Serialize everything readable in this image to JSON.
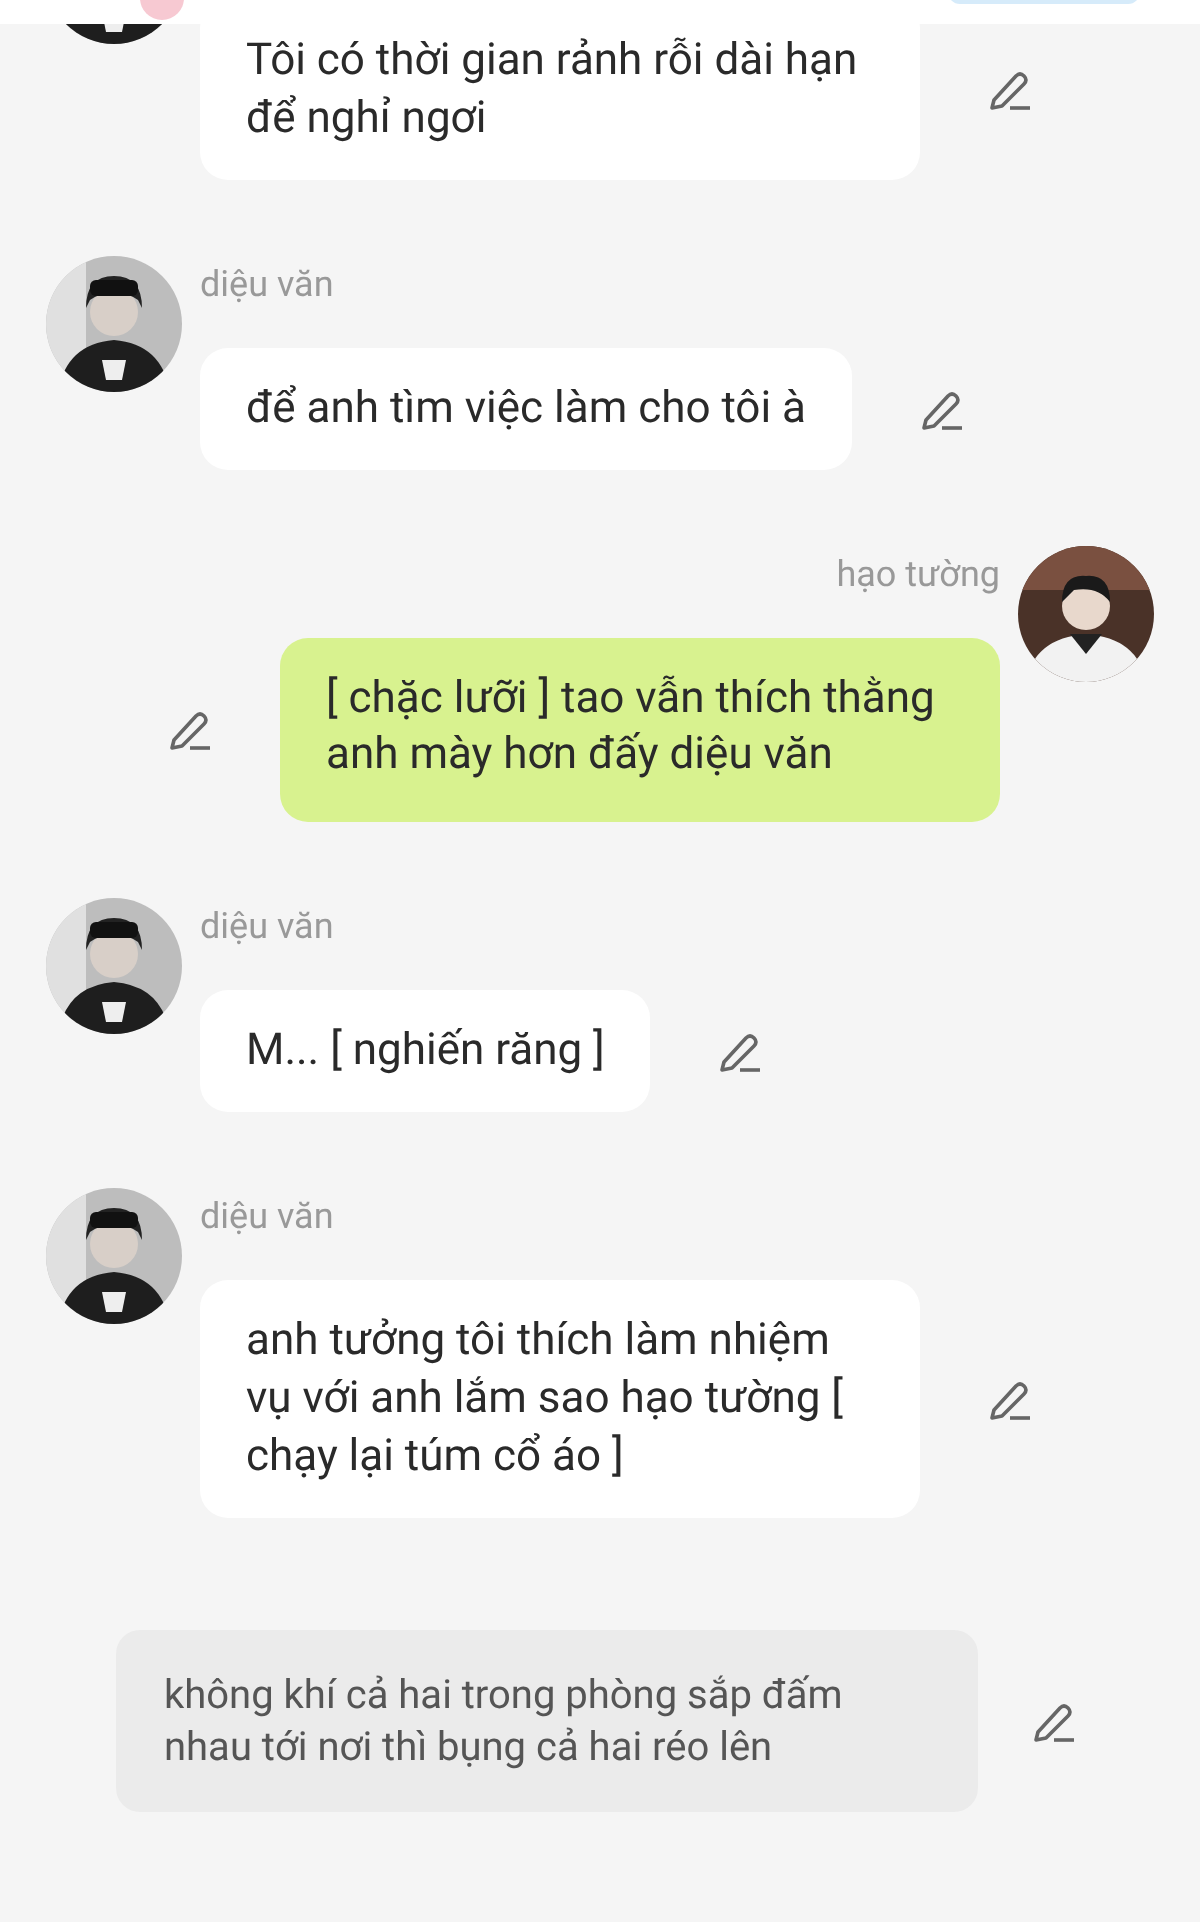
{
  "messages": [
    {
      "kind": "left",
      "text": "Tôi có thời gian rảnh rỗi dài hạn để nghỉ ngơi"
    },
    {
      "kind": "left",
      "name": "diệu văn",
      "text": "để anh tìm việc làm cho tôi à"
    },
    {
      "kind": "right",
      "name": "hạo tường",
      "text": "[ chặc lưỡi ] tao vẫn thích thằng anh mày hơn đấy diệu văn"
    },
    {
      "kind": "left",
      "name": "diệu văn",
      "text": "M... [ nghiến răng ]"
    },
    {
      "kind": "left",
      "name": "diệu văn",
      "text": "anh tưởng tôi thích làm nhiệm vụ với anh lắm sao hạo tường [ chạy lại túm cổ áo ]"
    },
    {
      "kind": "narration",
      "text": "không khí cả hai trong phòng sắp đấm nhau tới nơi thì bụng cả hai réo lên"
    }
  ]
}
